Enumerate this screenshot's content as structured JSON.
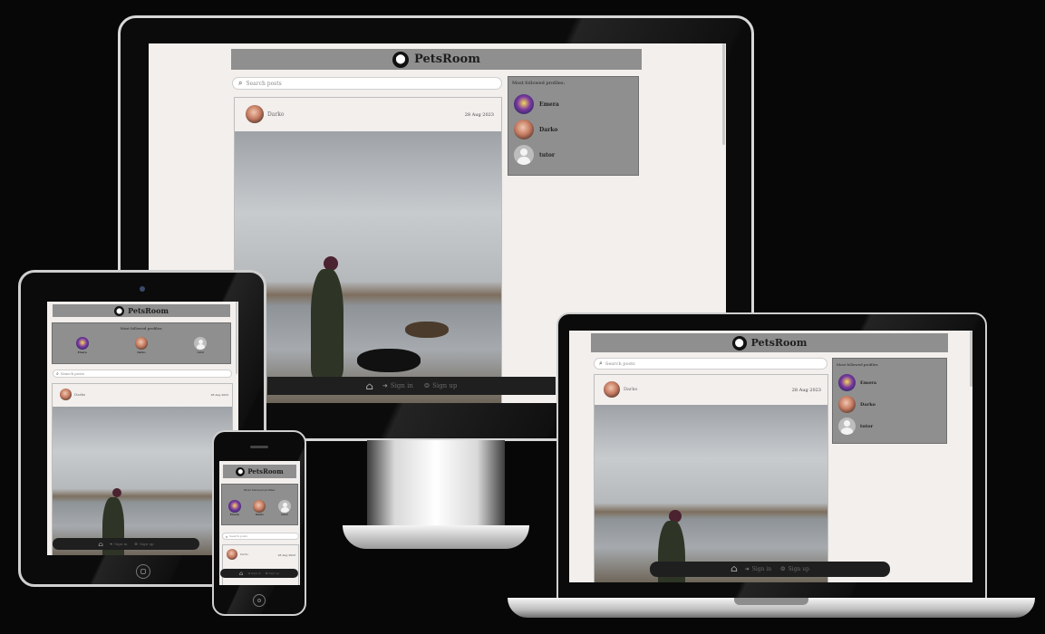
{
  "app": {
    "brand": "PetsRoom"
  },
  "search": {
    "placeholder": "Search posts"
  },
  "profiles": {
    "heading": "Most followed profiles:",
    "items": [
      {
        "name": "Emera"
      },
      {
        "name": "Darko"
      },
      {
        "name": "tutor"
      }
    ]
  },
  "post": {
    "author": "Darko",
    "date": "28 Aug 2023"
  },
  "nav": {
    "sign_in": "Sign in",
    "sign_up": "Sign up"
  },
  "icons": {
    "brand": "paw-icon",
    "search": "search-icon",
    "home": "home-icon",
    "sign_in": "sign-in-icon",
    "sign_up": "user-plus-icon"
  }
}
